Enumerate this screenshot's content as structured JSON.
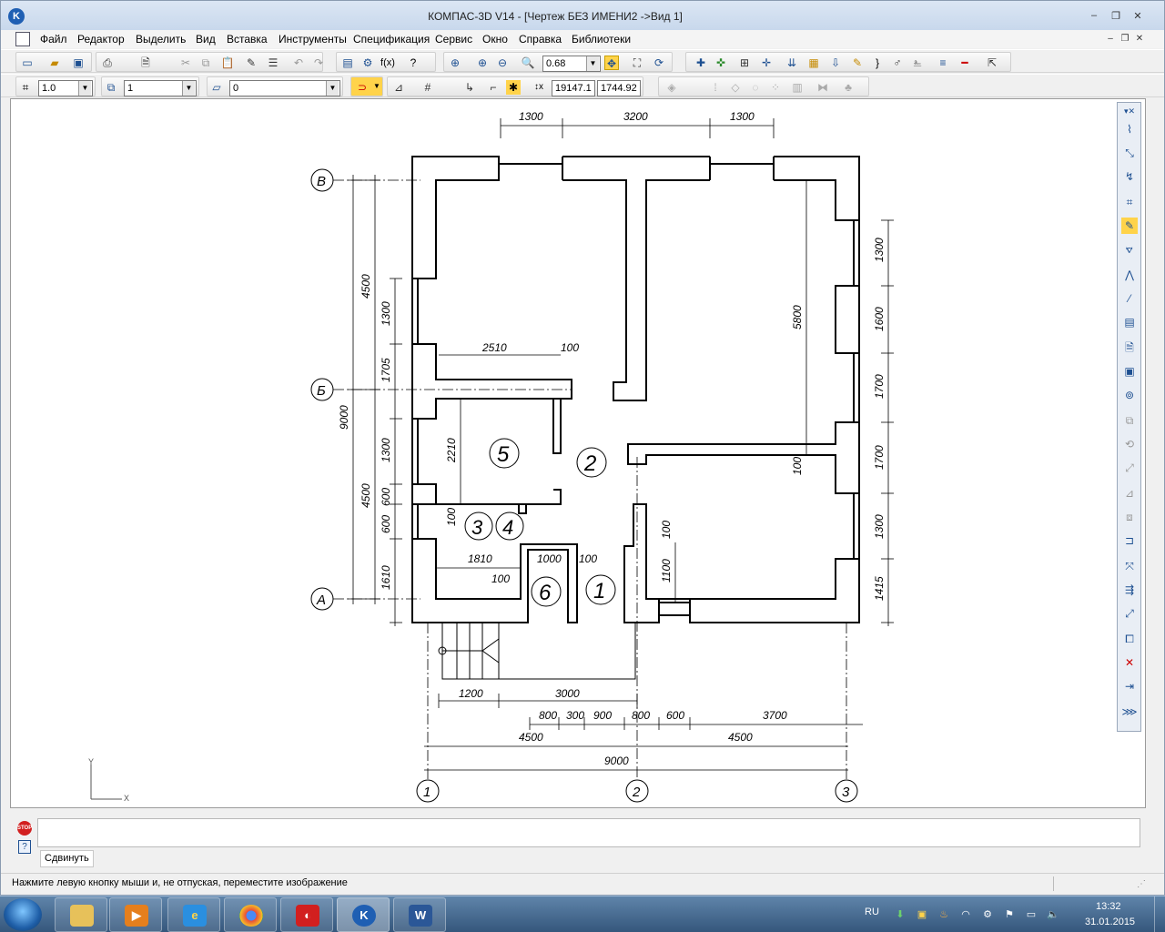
{
  "app": {
    "icon_letter": "K",
    "title": "КОМПАС-3D V14 - [Чертеж БЕЗ ИМЕНИ2 ->Вид 1]"
  },
  "window_controls": {
    "minimize": "–",
    "restore": "❐",
    "close": "✕"
  },
  "menu": {
    "items": [
      "Файл",
      "Редактор",
      "Выделить",
      "Вид",
      "Вставка",
      "Инструменты",
      "Спецификация",
      "Сервис",
      "Окно",
      "Справка",
      "Библиотеки"
    ]
  },
  "toolbar": {
    "zoom_value": "0.68",
    "scale_value": "1.0",
    "layer_value": "1",
    "style_value": "0",
    "coord_x": "19147.1",
    "coord_y": "1744.92"
  },
  "drawing": {
    "axis_letters": {
      "v": "В",
      "b": "Б",
      "a": "А"
    },
    "axis_numbers": {
      "n1": "1",
      "n2": "2",
      "n3": "3"
    },
    "rooms": {
      "r1": "1",
      "r2": "2",
      "r3": "3",
      "r4": "4",
      "r5": "5",
      "r6": "6"
    },
    "dims_top": {
      "d1": "1300",
      "d2": "3200",
      "d3": "1300"
    },
    "dims_left_outer": {
      "d1": "4500",
      "d2": "9000",
      "d3": "4500"
    },
    "dims_left_inner": {
      "d1": "1300",
      "d2": "1705",
      "d3": "1300",
      "d4": "600",
      "d5": "600",
      "d6": "1610"
    },
    "dims_right": {
      "d1": "1300",
      "d2": "1600",
      "d3": "1700",
      "d4": "1700",
      "d5": "1300",
      "d6": "1415"
    },
    "dims_bottom_1": {
      "d1": "1200",
      "d2": "3000"
    },
    "dims_bottom_2": {
      "d1": "800",
      "d2": "300",
      "d3": "900",
      "d4": "800",
      "d5": "600",
      "d6": "3700"
    },
    "dims_bottom_3": {
      "d1": "4500",
      "d2": "4500"
    },
    "dims_bottom_4": {
      "d1": "9000"
    },
    "dims_inner": {
      "room_w": "2510",
      "wall_t": "100",
      "h5800": "5800",
      "h2210": "2210",
      "t100a": "100",
      "t100b": "100",
      "w1810": "1810",
      "w1000": "1000",
      "t100c": "100",
      "t100d": "100",
      "d1100": "1100",
      "t100e": "100",
      "t100f": "100"
    },
    "ucs": {
      "x": "X",
      "y": "Y"
    }
  },
  "command": {
    "stop_label": "STOP",
    "help_label": "?",
    "button_label": "Сдвинуть"
  },
  "status": {
    "text": "Нажмите левую кнопку мыши и, не отпуская, переместите изображение"
  },
  "taskbar": {
    "lang": "RU",
    "time": "13:32",
    "date": "31.01.2015"
  }
}
